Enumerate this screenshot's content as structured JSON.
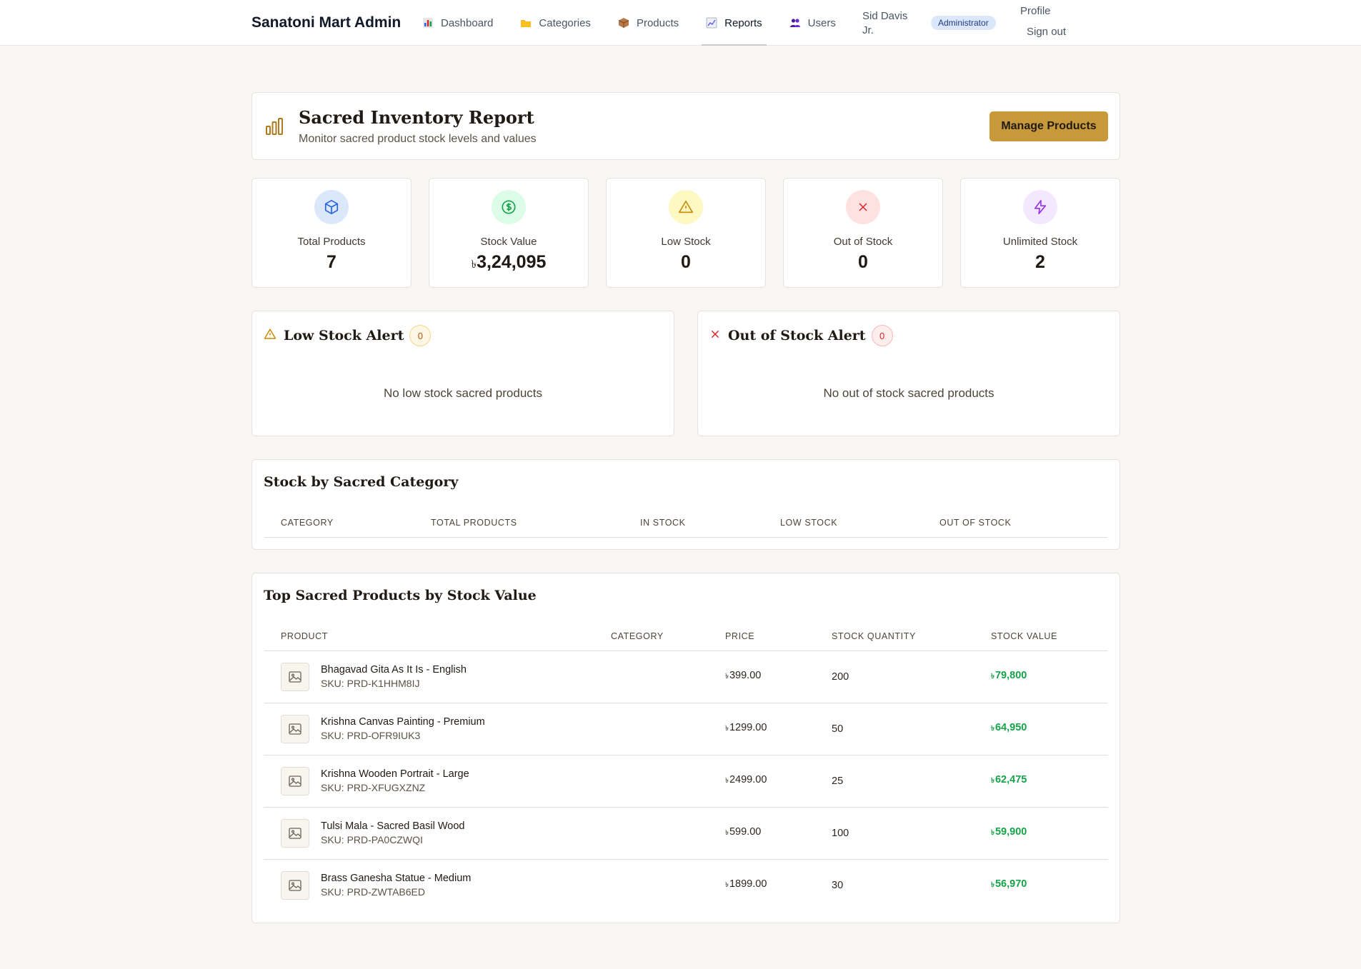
{
  "header": {
    "brand": "Sanatoni Mart Admin",
    "nav": [
      {
        "label": "Dashboard",
        "icon": "bar-chart-icon",
        "color": "#d97706"
      },
      {
        "label": "Categories",
        "icon": "folder-icon",
        "color": "#eab308"
      },
      {
        "label": "Products",
        "icon": "package-icon",
        "color": "#b45309"
      },
      {
        "label": "Reports",
        "icon": "trend-chart-icon",
        "color": "#6b7280",
        "active": true
      },
      {
        "label": "Users",
        "icon": "users-icon",
        "color": "#6d28d9"
      }
    ],
    "user_name": "Sid Davis Jr.",
    "role": "Administrator",
    "profile": "Profile",
    "signout": "Sign out"
  },
  "report": {
    "title": "Sacred Inventory Report",
    "subtitle": "Monitor sacred product stock levels and values",
    "manage_button": "Manage Products"
  },
  "stats": [
    {
      "label": "Total Products",
      "value": "7",
      "icon": "box-icon",
      "bg": "#dbe7fb",
      "fg": "#2563eb"
    },
    {
      "label": "Stock Value",
      "value": "3,24,095",
      "currency": "৳",
      "icon": "dollar-icon",
      "bg": "#dcfce7",
      "fg": "#16a34a"
    },
    {
      "label": "Low Stock",
      "value": "0",
      "icon": "warning-icon",
      "bg": "#fef9c3",
      "fg": "#ca8a04"
    },
    {
      "label": "Out of Stock",
      "value": "0",
      "icon": "x-icon",
      "bg": "#fee2e2",
      "fg": "#dc2626"
    },
    {
      "label": "Unlimited Stock",
      "value": "2",
      "icon": "lightning-icon",
      "bg": "#f3e8ff",
      "fg": "#9333ea"
    }
  ],
  "low_stock_alert": {
    "title": "Low Stock Alert",
    "count": "0",
    "empty": "No low stock sacred products"
  },
  "out_stock_alert": {
    "title": "Out of Stock Alert",
    "count": "0",
    "empty": "No out of stock sacred products"
  },
  "category_table": {
    "title": "Stock by Sacred Category",
    "headers": [
      "CATEGORY",
      "TOTAL PRODUCTS",
      "IN STOCK",
      "LOW STOCK",
      "OUT OF STOCK"
    ]
  },
  "top_products": {
    "title": "Top Sacred Products by Stock Value",
    "headers": [
      "PRODUCT",
      "CATEGORY",
      "PRICE",
      "STOCK QUANTITY",
      "STOCK VALUE"
    ],
    "currency": "৳",
    "rows": [
      {
        "name": "Bhagavad Gita As It Is - English",
        "sku": "SKU: PRD-K1HHM8IJ",
        "category": "",
        "price": "399.00",
        "qty": "200",
        "value": "79,800"
      },
      {
        "name": "Krishna Canvas Painting - Premium",
        "sku": "SKU: PRD-OFR9IUK3",
        "category": "",
        "price": "1299.00",
        "qty": "50",
        "value": "64,950"
      },
      {
        "name": "Krishna Wooden Portrait - Large",
        "sku": "SKU: PRD-XFUGXZNZ",
        "category": "",
        "price": "2499.00",
        "qty": "25",
        "value": "62,475"
      },
      {
        "name": "Tulsi Mala - Sacred Basil Wood",
        "sku": "SKU: PRD-PA0CZWQI",
        "category": "",
        "price": "599.00",
        "qty": "100",
        "value": "59,900"
      },
      {
        "name": "Brass Ganesha Statue - Medium",
        "sku": "SKU: PRD-ZWTAB6ED",
        "category": "",
        "price": "1899.00",
        "qty": "30",
        "value": "56,970"
      }
    ]
  }
}
